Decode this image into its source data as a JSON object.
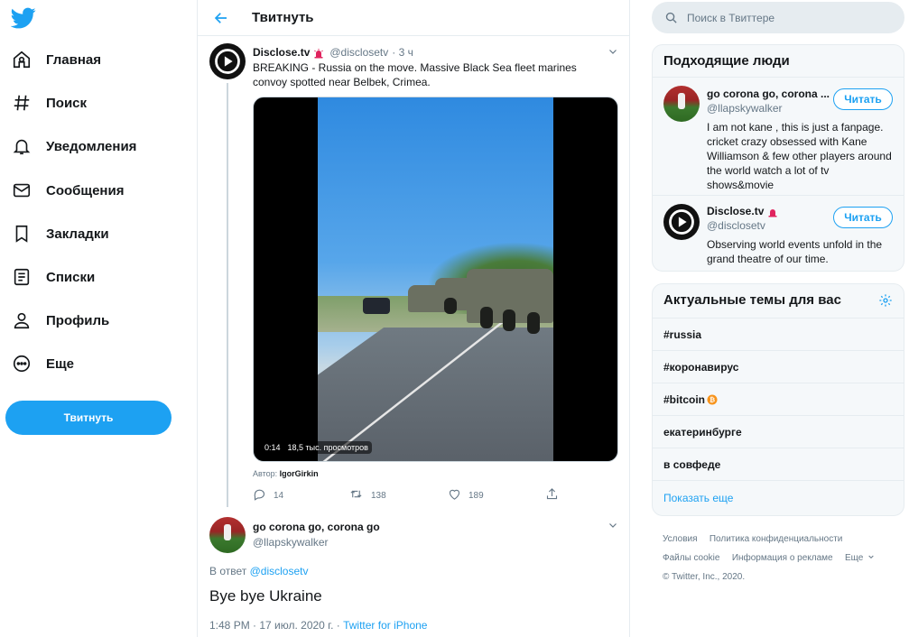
{
  "nav": {
    "items": [
      {
        "label": "Главная",
        "icon": "home-icon"
      },
      {
        "label": "Поиск",
        "icon": "hash-icon"
      },
      {
        "label": "Уведомления",
        "icon": "bell-icon"
      },
      {
        "label": "Сообщения",
        "icon": "envelope-icon"
      },
      {
        "label": "Закладки",
        "icon": "bookmark-icon"
      },
      {
        "label": "Списки",
        "icon": "list-icon"
      },
      {
        "label": "Профиль",
        "icon": "person-icon"
      },
      {
        "label": "Еще",
        "icon": "more-icon"
      }
    ],
    "tweet_button": "Твитнуть"
  },
  "header": {
    "title": "Твитнуть"
  },
  "tweet": {
    "author_name": "Disclose.tv",
    "author_handle": "@disclosetv",
    "time": "· 3 ч",
    "text": "BREAKING - Russia on the move. Massive Black Sea fleet marines convoy spotted near Belbek, Crimea.",
    "video_duration": "0:14",
    "video_views": "18,5 тыс. просмотров",
    "credit_prefix": "Автор:",
    "credit_author": "IgorGirkin",
    "replies": "14",
    "retweets": "138",
    "likes": "189"
  },
  "reply": {
    "author_name": "go corona go, corona go",
    "author_handle": "@llapskywalker",
    "reply_to_prefix": "В ответ",
    "reply_to_handle": "@disclosetv",
    "text": "Bye bye Ukraine",
    "timestamp": "1:48 PM · 17 июл. 2020 г. ·",
    "source": "Twitter for iPhone"
  },
  "search": {
    "placeholder": "Поиск в Твиттере"
  },
  "who_to_follow": {
    "title": "Подходящие люди",
    "follow_label": "Читать",
    "users": [
      {
        "name": "go corona go, corona ...",
        "handle": "@llapskywalker",
        "bio": "I am not kane , this is just a fanpage. cricket crazy obsessed with Kane Williamson & few other players around the world watch a lot of tv shows&movie"
      },
      {
        "name": "Disclose.tv",
        "handle": "@disclosetv",
        "bio": "Observing world events unfold in the grand theatre of our time."
      }
    ]
  },
  "trends": {
    "title": "Актуальные темы для вас",
    "items": [
      "#russia",
      "#коронавирус",
      "#bitcoin",
      "екатеринбурге",
      "в совфеде"
    ],
    "show_more": "Показать еще"
  },
  "footer": {
    "links": [
      "Условия",
      "Политика конфиденциальности",
      "Файлы cookie",
      "Информация о рекламе",
      "Еще"
    ],
    "copyright": "© Twitter, Inc., 2020."
  },
  "colors": {
    "accent": "#1da1f2",
    "text": "#14171a",
    "muted": "#657786",
    "border": "#e6ecf0",
    "bitcoin": "#f7931a"
  }
}
